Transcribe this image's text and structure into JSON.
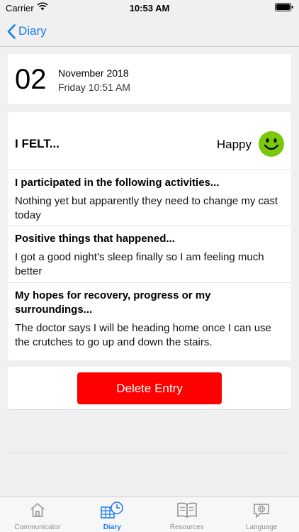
{
  "status_bar": {
    "carrier": "Carrier",
    "time": "10:53 AM"
  },
  "nav": {
    "back_label": "Diary"
  },
  "date": {
    "day": "02",
    "month_year": "November 2018",
    "weekday_time": "Friday 10:51 AM"
  },
  "entry": {
    "felt_label": "I FELT...",
    "mood": "Happy",
    "mood_icon": "smiley-icon",
    "mood_color": "#7ac70c",
    "sections": [
      {
        "title": "I participated in the following activities...",
        "body": "Nothing yet but apparently they need to change my cast today"
      },
      {
        "title": "Positive things that happened...",
        "body": "I got a good night’s sleep finally so I am feeling much better"
      },
      {
        "title": "My hopes for recovery, progress or my surroundings...",
        "body": "The doctor says I will be heading home once I can use the crutches to go up and down the stairs."
      }
    ]
  },
  "actions": {
    "delete_label": "Delete Entry",
    "delete_color": "#ff0000"
  },
  "tabs": [
    {
      "label": "Communicator",
      "icon": "home-icon"
    },
    {
      "label": "Diary",
      "icon": "diary-calendar-icon",
      "active": true
    },
    {
      "label": "Resources",
      "icon": "book-icon"
    },
    {
      "label": "Language",
      "icon": "language-globe-icon"
    }
  ],
  "colors": {
    "accent": "#1a7bf0",
    "background": "#f0f0f0"
  }
}
